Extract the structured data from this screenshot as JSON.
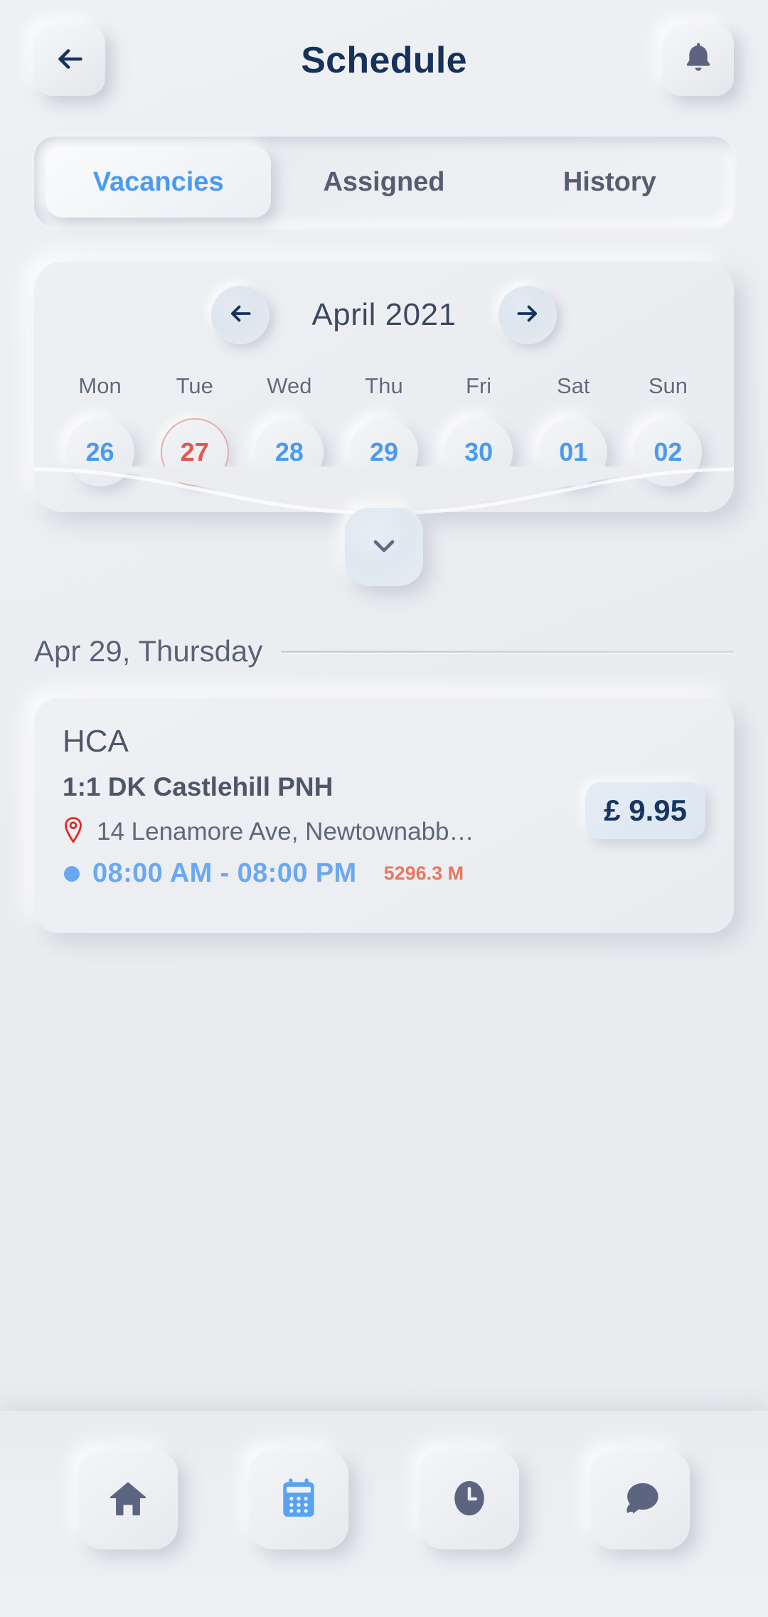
{
  "header": {
    "title": "Schedule",
    "back_icon": "arrow-left-icon",
    "notification_icon": "bell-icon"
  },
  "tabs": [
    {
      "label": "Vacancies",
      "active": true
    },
    {
      "label": "Assigned",
      "active": false
    },
    {
      "label": "History",
      "active": false
    }
  ],
  "calendar": {
    "month_label": "April 2021",
    "prev_icon": "arrow-left-icon",
    "next_icon": "arrow-right-icon",
    "expand_icon": "chevron-down-icon",
    "weekdays": [
      "Mon",
      "Tue",
      "Wed",
      "Thu",
      "Fri",
      "Sat",
      "Sun"
    ],
    "days": [
      {
        "label": "26",
        "state": "normal"
      },
      {
        "label": "27",
        "state": "today"
      },
      {
        "label": "28",
        "state": "normal"
      },
      {
        "label": "29",
        "state": "normal"
      },
      {
        "label": "30",
        "state": "normal"
      },
      {
        "label": "01",
        "state": "normal"
      },
      {
        "label": "02",
        "state": "normal"
      }
    ]
  },
  "section": {
    "date_label": "Apr 29, Thursday"
  },
  "job": {
    "title": "HCA",
    "subtitle": "1:1 DK Castlehill PNH",
    "address": "14 Lenamore Ave, Newtownabb…",
    "address_icon": "map-pin-icon",
    "time_range": "08:00 AM - 08:00 PM",
    "distance": "5296.3 M",
    "price": "£ 9.95"
  },
  "bottom_nav": [
    {
      "icon": "home-icon",
      "active": false
    },
    {
      "icon": "calendar-icon",
      "active": true
    },
    {
      "icon": "clock-icon",
      "active": false
    },
    {
      "icon": "chat-bubble-icon",
      "active": false
    }
  ],
  "colors": {
    "accent_blue": "#4a9bf0",
    "title_navy": "#16325c",
    "today_red": "#e0594c",
    "distance_coral": "#e4795f",
    "text_slate": "#4e5668",
    "background": "#eceef1"
  }
}
